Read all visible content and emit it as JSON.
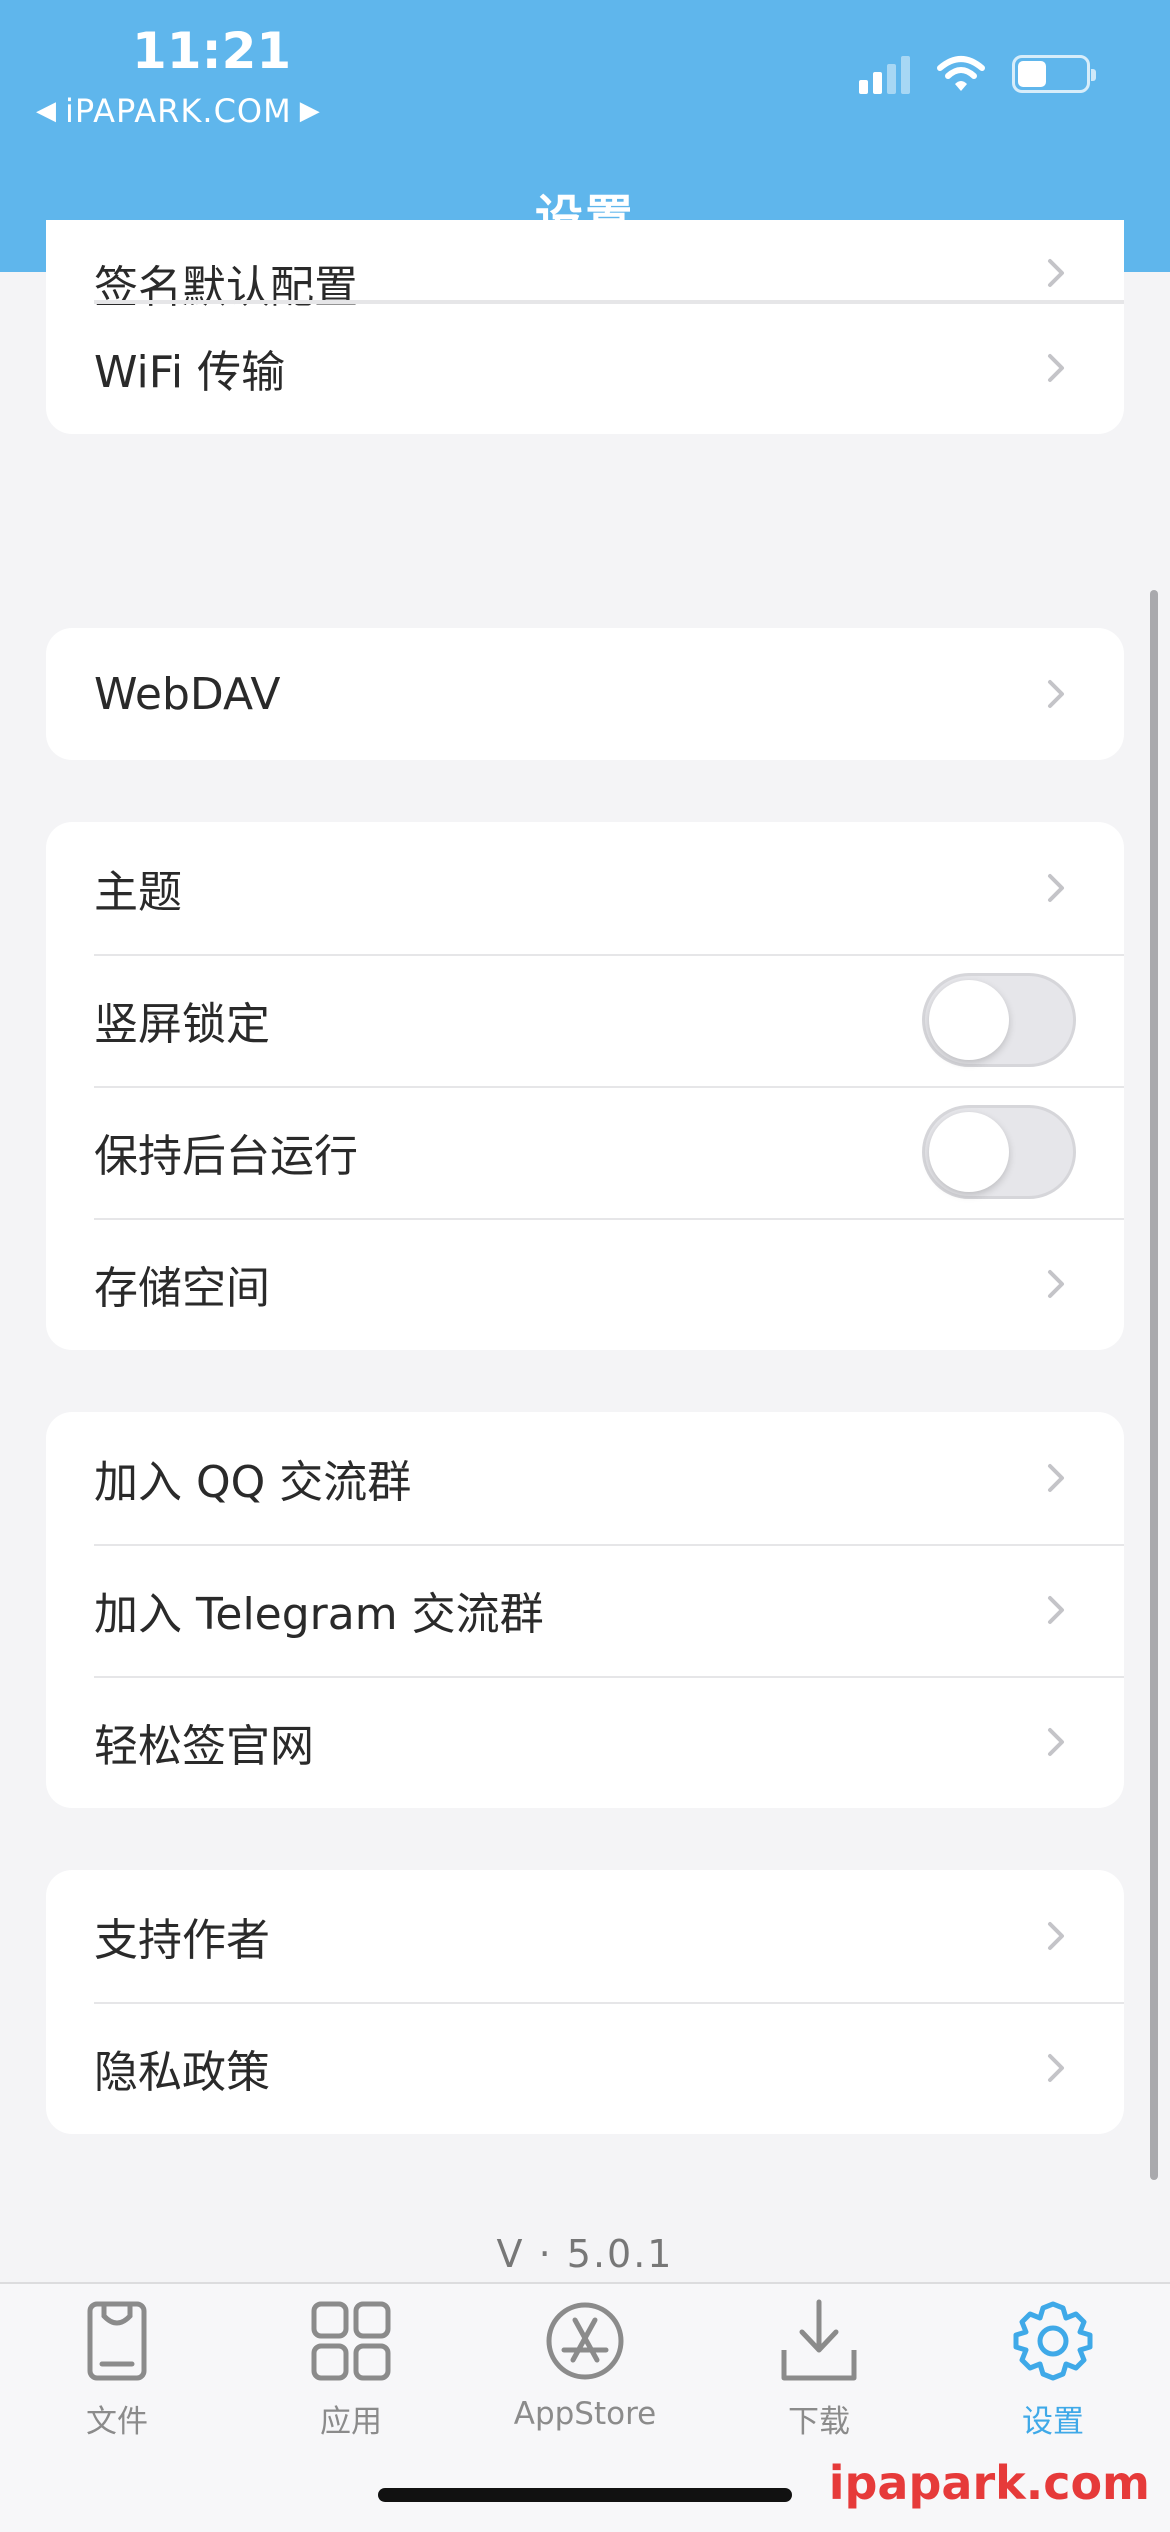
{
  "status_bar": {
    "time": "11:21",
    "back_link": "iPAPARK.COM",
    "battery_level": 0.42
  },
  "header": {
    "title": "设置"
  },
  "groups": [
    {
      "rows": [
        {
          "label": "签名默认配置",
          "control": "chevron"
        },
        {
          "label": "WiFi 传输",
          "control": "chevron"
        }
      ]
    },
    {
      "rows": [
        {
          "label": "WebDAV",
          "control": "chevron"
        }
      ]
    },
    {
      "rows": [
        {
          "label": "主题",
          "control": "chevron"
        },
        {
          "label": "竖屏锁定",
          "control": "toggle",
          "on": false
        },
        {
          "label": "保持后台运行",
          "control": "toggle",
          "on": false
        },
        {
          "label": "存储空间",
          "control": "chevron"
        }
      ]
    },
    {
      "rows": [
        {
          "label": "加入 QQ 交流群",
          "control": "chevron"
        },
        {
          "label": "加入 Telegram 交流群",
          "control": "chevron"
        },
        {
          "label": "轻松签官网",
          "control": "chevron"
        }
      ]
    },
    {
      "rows": [
        {
          "label": "支持作者",
          "control": "chevron"
        },
        {
          "label": "隐私政策",
          "control": "chevron"
        }
      ]
    }
  ],
  "version": "V · 5.0.1",
  "tabbar": {
    "items": [
      {
        "label": "文件",
        "icon": "file-icon",
        "active": false
      },
      {
        "label": "应用",
        "icon": "apps-grid-icon",
        "active": false
      },
      {
        "label": "AppStore",
        "icon": "appstore-icon",
        "active": false
      },
      {
        "label": "下载",
        "icon": "download-icon",
        "active": false
      },
      {
        "label": "设置",
        "icon": "gear-icon",
        "active": true
      }
    ]
  },
  "watermark": "ipapark.com"
}
